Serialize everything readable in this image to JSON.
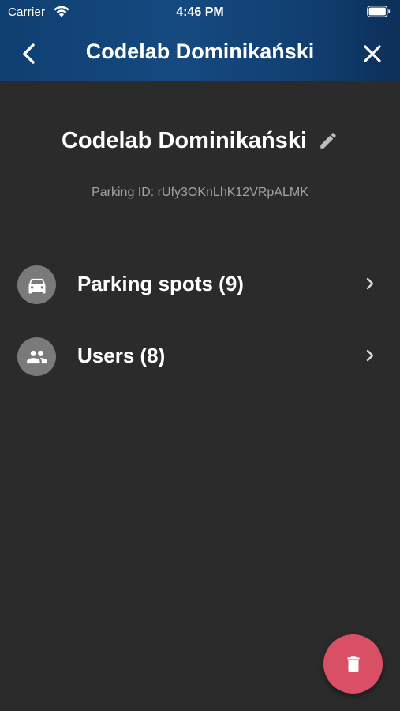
{
  "status_bar": {
    "carrier": "Carrier",
    "time": "4:46 PM"
  },
  "nav": {
    "title": "Codelab Dominikański",
    "back_icon": "chevron-left-icon",
    "close_icon": "close-icon"
  },
  "parking": {
    "name": "Codelab Dominikański",
    "id_line": "Parking ID: rUfy3OKnLhK12VRpALMK",
    "edit_icon": "pencil-icon"
  },
  "list": [
    {
      "label": "Parking spots (9)",
      "icon": "car-icon"
    },
    {
      "label": "Users (8)",
      "icon": "people-icon"
    }
  ],
  "fab": {
    "icon": "trash-icon",
    "color": "#d94f66"
  },
  "colors": {
    "background": "#2b2b2b",
    "header_gradient_start": "#0f3f71",
    "header_gradient_end": "#0b2f58",
    "avatar": "#7a7a7a",
    "muted_text": "#a3a3a3"
  }
}
